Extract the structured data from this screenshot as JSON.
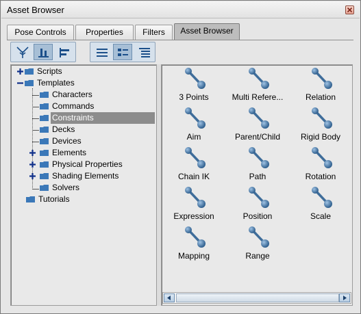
{
  "window": {
    "title": "Asset Browser",
    "close_icon": "close-x-icon"
  },
  "tabs": [
    {
      "label": "Pose Controls",
      "active": false
    },
    {
      "label": "Properties",
      "active": false
    },
    {
      "label": "Filters",
      "active": false
    },
    {
      "label": "Asset Browser",
      "active": true
    }
  ],
  "toolbar": {
    "view_buttons": [
      {
        "icon": "tree-view-icon",
        "pressed": false
      },
      {
        "icon": "align-bottom-icon",
        "pressed": true
      },
      {
        "icon": "align-left-icon",
        "pressed": false
      }
    ],
    "display_buttons": [
      {
        "icon": "list-view-icon",
        "pressed": false
      },
      {
        "icon": "icon-view-icon",
        "pressed": true
      },
      {
        "icon": "detail-view-icon",
        "pressed": false
      }
    ]
  },
  "tree": [
    {
      "label": "Scripts",
      "expander": "plus"
    },
    {
      "label": "Templates",
      "expander": "minus"
    },
    {
      "label": "Characters",
      "expander": "none"
    },
    {
      "label": "Commands",
      "expander": "none"
    },
    {
      "label": "Constraints",
      "expander": "none",
      "selected": true
    },
    {
      "label": "Decks",
      "expander": "none"
    },
    {
      "label": "Devices",
      "expander": "none"
    },
    {
      "label": "Elements",
      "expander": "plus"
    },
    {
      "label": "Physical Properties",
      "expander": "plus"
    },
    {
      "label": "Shading Elements",
      "expander": "plus"
    },
    {
      "label": "Solvers",
      "expander": "none"
    },
    {
      "label": "Tutorials",
      "expander": "none"
    }
  ],
  "assets": [
    {
      "label": "3 Points"
    },
    {
      "label": "Multi Refere..."
    },
    {
      "label": "Relation"
    },
    {
      "label": "Aim"
    },
    {
      "label": "Parent/Child"
    },
    {
      "label": "Rigid Body"
    },
    {
      "label": "Chain IK"
    },
    {
      "label": "Path"
    },
    {
      "label": "Rotation"
    },
    {
      "label": "Expression"
    },
    {
      "label": "Position"
    },
    {
      "label": "Scale"
    },
    {
      "label": "Mapping"
    },
    {
      "label": "Range"
    }
  ],
  "scrollbar": {
    "left_icon": "arrow-left-icon",
    "right_icon": "arrow-right-icon"
  },
  "colors": {
    "selection": "#8c8c8c",
    "toolbar_accent": "#a7bfd6",
    "constraint_icon": "#3f6d9a"
  }
}
